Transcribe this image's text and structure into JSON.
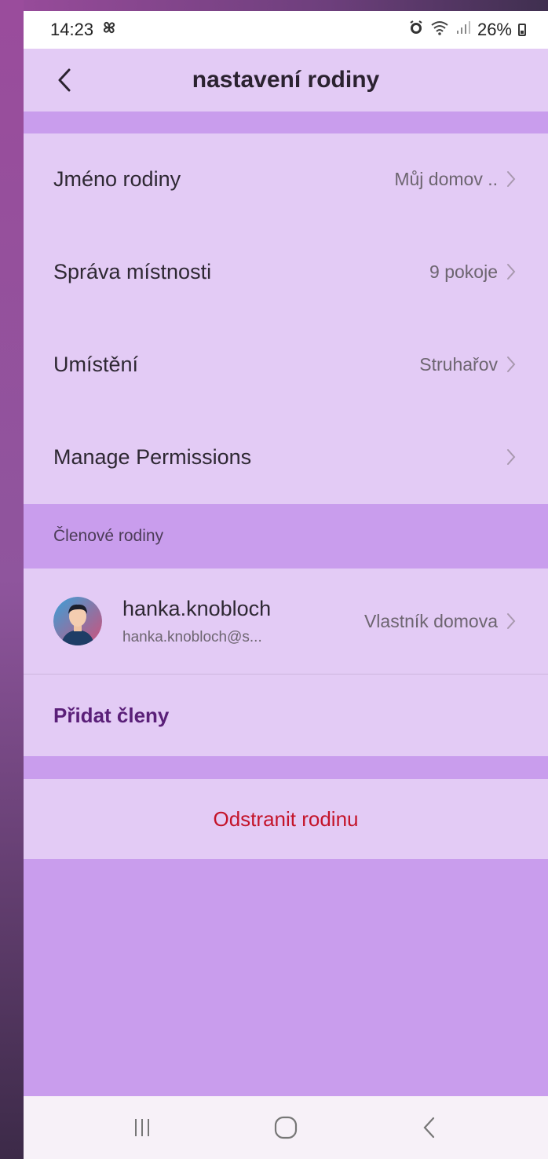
{
  "status_bar": {
    "time": "14:23",
    "fan_icon": "fan-icon",
    "battery": "26%",
    "icons": "alarm wifi signal"
  },
  "header": {
    "title": "nastavení rodiny",
    "back_icon": "chevron-left-icon"
  },
  "settings": [
    {
      "label": "Jméno rodiny",
      "value": "Můj domov .."
    },
    {
      "label": "Správa místnosti",
      "value": "9 pokoje"
    },
    {
      "label": "Umístění",
      "value": "Struhařov"
    },
    {
      "label": "Manage Permissions",
      "value": ""
    }
  ],
  "members_section": {
    "heading": "Členové rodiny",
    "members": [
      {
        "name": "hanka.knobloch",
        "email": "hanka.knobloch@s...",
        "role": "Vlastník domova"
      }
    ],
    "add_label": "Přidat členy"
  },
  "delete": {
    "label": "Odstranit rodinu"
  },
  "nav": {
    "recents_icon": "recents-icon",
    "home_icon": "home-icon",
    "back_icon": "back-icon"
  },
  "colors": {
    "card": "#e3cbf5",
    "band": "#c99ded",
    "accent": "#5a1f78",
    "danger": "#c4142a"
  }
}
